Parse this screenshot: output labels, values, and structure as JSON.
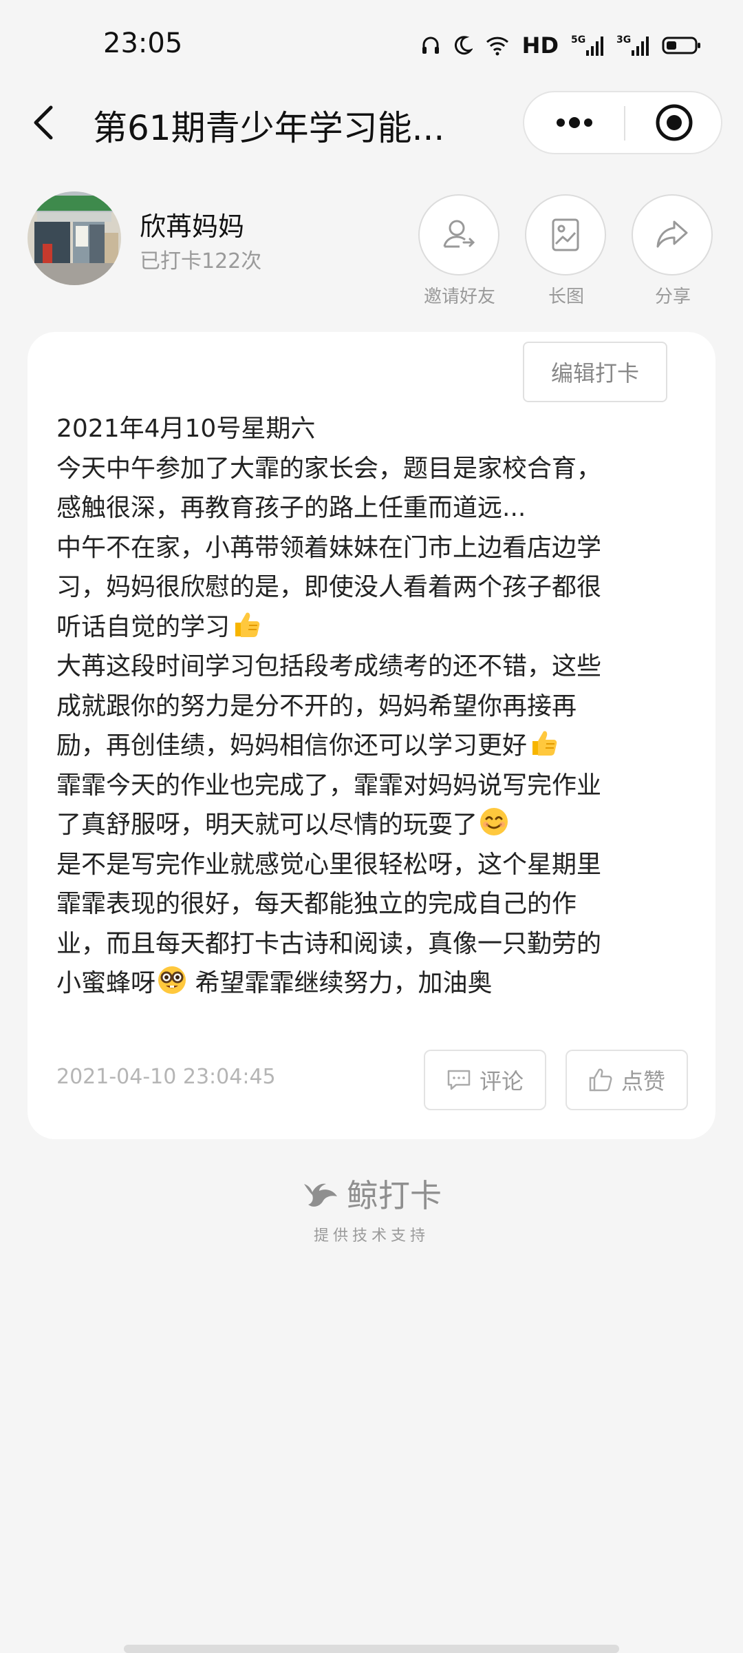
{
  "status_bar": {
    "time": "23:05",
    "network_label": "HD",
    "signal_1_label": "5G",
    "signal_2_label": "3G"
  },
  "header": {
    "title": "第61期青少年学习能..."
  },
  "profile": {
    "name": "欣苒妈妈",
    "checkin_count_text": "已打卡122次",
    "actions": [
      {
        "label": "邀请好友",
        "icon": "invite-friend-icon"
      },
      {
        "label": "长图",
        "icon": "image-icon"
      },
      {
        "label": "分享",
        "icon": "share-icon"
      }
    ]
  },
  "post": {
    "edit_label": "编辑打卡",
    "lines": [
      "2021年4月10号星期六",
      "今天中午参加了大霏的家长会，题目是家校合育，",
      "感触很深，再教育孩子的路上任重而道远...",
      "中午不在家，小苒带领着妹妹在门市上边看店边学",
      "习，妈妈很欣慰的是，即使没人看着两个孩子都很",
      "听话自觉的学习",
      "大苒这段时间学习包括段考成绩考的还不错，这些",
      "成就跟你的努力是分不开的，妈妈希望你再接再",
      "励，再创佳绩，妈妈相信你还可以学习更好",
      "霏霏今天的作业也完成了，霏霏对妈妈说写完作业",
      "了真舒服呀，明天就可以尽情的玩耍了",
      "是不是写完作业就感觉心里很轻松呀，这个星期里",
      "霏霏表现的很好，每天都能独立的完成自己的作",
      "业，而且每天都打卡古诗和阅读，真像一只勤劳的",
      "小蜜蜂呀",
      " 希望霏霏继续努力，加油奥"
    ],
    "timestamp": "2021-04-10 23:04:45",
    "comment_label": "评论",
    "like_label": "点赞"
  },
  "footer": {
    "brand_name": "鲸打卡",
    "brand_sub": "提供技术支持"
  },
  "colors": {
    "accent_gray": "#9a9a9a",
    "emoji_yellow": "#f7b500"
  }
}
